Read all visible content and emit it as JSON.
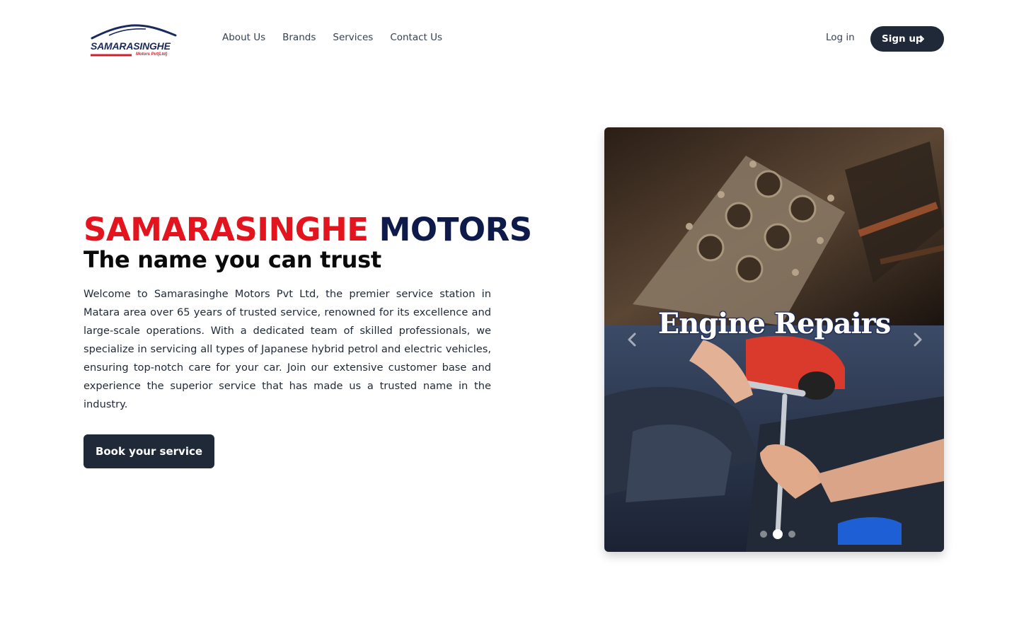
{
  "header": {
    "logo": {
      "name": "SAMARASINGHE",
      "sub": "Motors Pvt(Ltd)"
    },
    "nav": [
      {
        "label": "About Us"
      },
      {
        "label": "Brands"
      },
      {
        "label": "Services"
      },
      {
        "label": "Contact Us"
      }
    ],
    "login_label": "Log in",
    "signup_label": "Sign up",
    "signup_icon": "chevron-right-icon"
  },
  "hero": {
    "title_red": "SAMARASINGHE",
    "title_navy": "MOTORS",
    "subtitle": "The name you can trust",
    "description": "Welcome to Samarasinghe Motors Pvt Ltd, the premier service station in Matara area over 65 years of trusted service, renowned for its excellence and large-scale operations. With a dedicated team of skilled professionals, we specialize in servicing all types of Japanese hybrid petrol and electric vehicles, ensuring top-notch care for your car. Join our extensive customer base and experience the superior service that has made us a trusted name in the industry.",
    "cta_label": "Book your service"
  },
  "carousel": {
    "slide_title": "Engine Repairs",
    "prev_icon": "chevron-left-icon",
    "next_icon": "chevron-right-icon",
    "active_slide": 2,
    "slide_count": 3
  },
  "colors": {
    "brand_red": "#e3141d",
    "brand_navy": "#0d1a4a",
    "button_dark": "#1f2937"
  }
}
